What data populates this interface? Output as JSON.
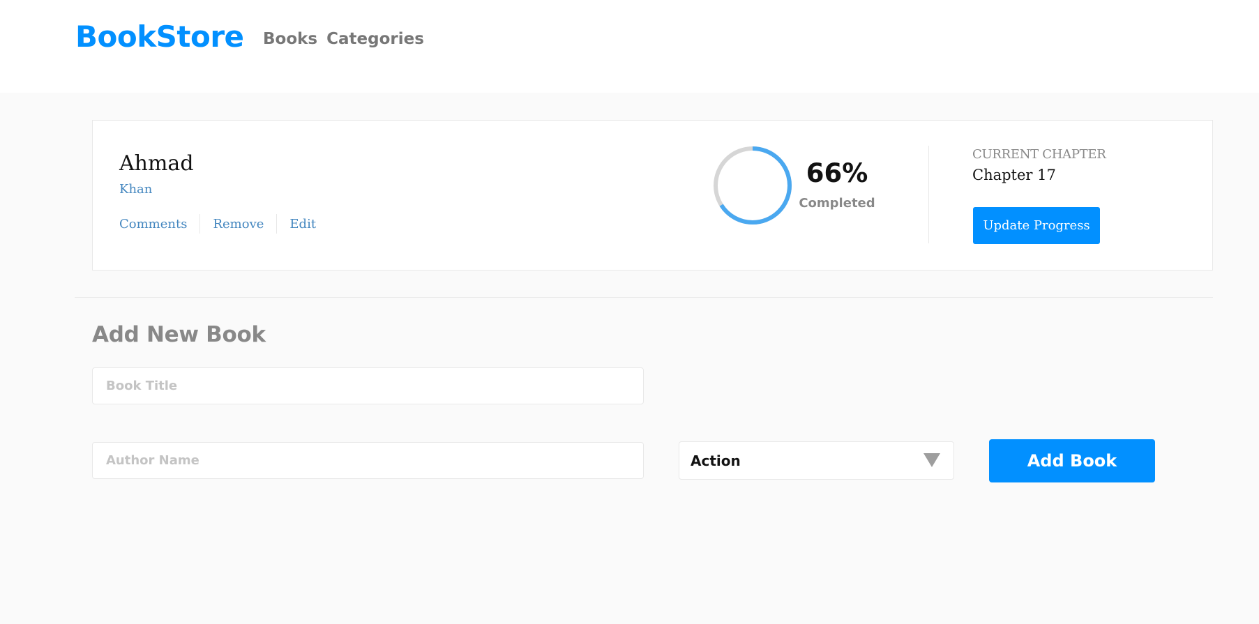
{
  "header": {
    "logo": "BookStore",
    "nav": [
      "Books",
      "Categories"
    ]
  },
  "book": {
    "title": "Ahmad",
    "author": "Khan",
    "actions": [
      "Comments",
      "Remove",
      "Edit"
    ],
    "progress_value": 0.66,
    "progress_text": "66%",
    "completed_label": "Completed",
    "current_chapter_label": "CURRENT CHAPTER",
    "current_chapter": "Chapter 17",
    "update_button": "Update Progress"
  },
  "form": {
    "heading": "Add New Book",
    "title_placeholder": "Book Title",
    "author_placeholder": "Author Name",
    "category_selected": "Action",
    "submit_label": "Add Book"
  },
  "colors": {
    "accent": "#0290ff",
    "progress": "#4aa8f0",
    "track": "#d6d6d6",
    "link": "#4386bf"
  },
  "icons": {
    "select_arrow": "caret-down-icon"
  }
}
